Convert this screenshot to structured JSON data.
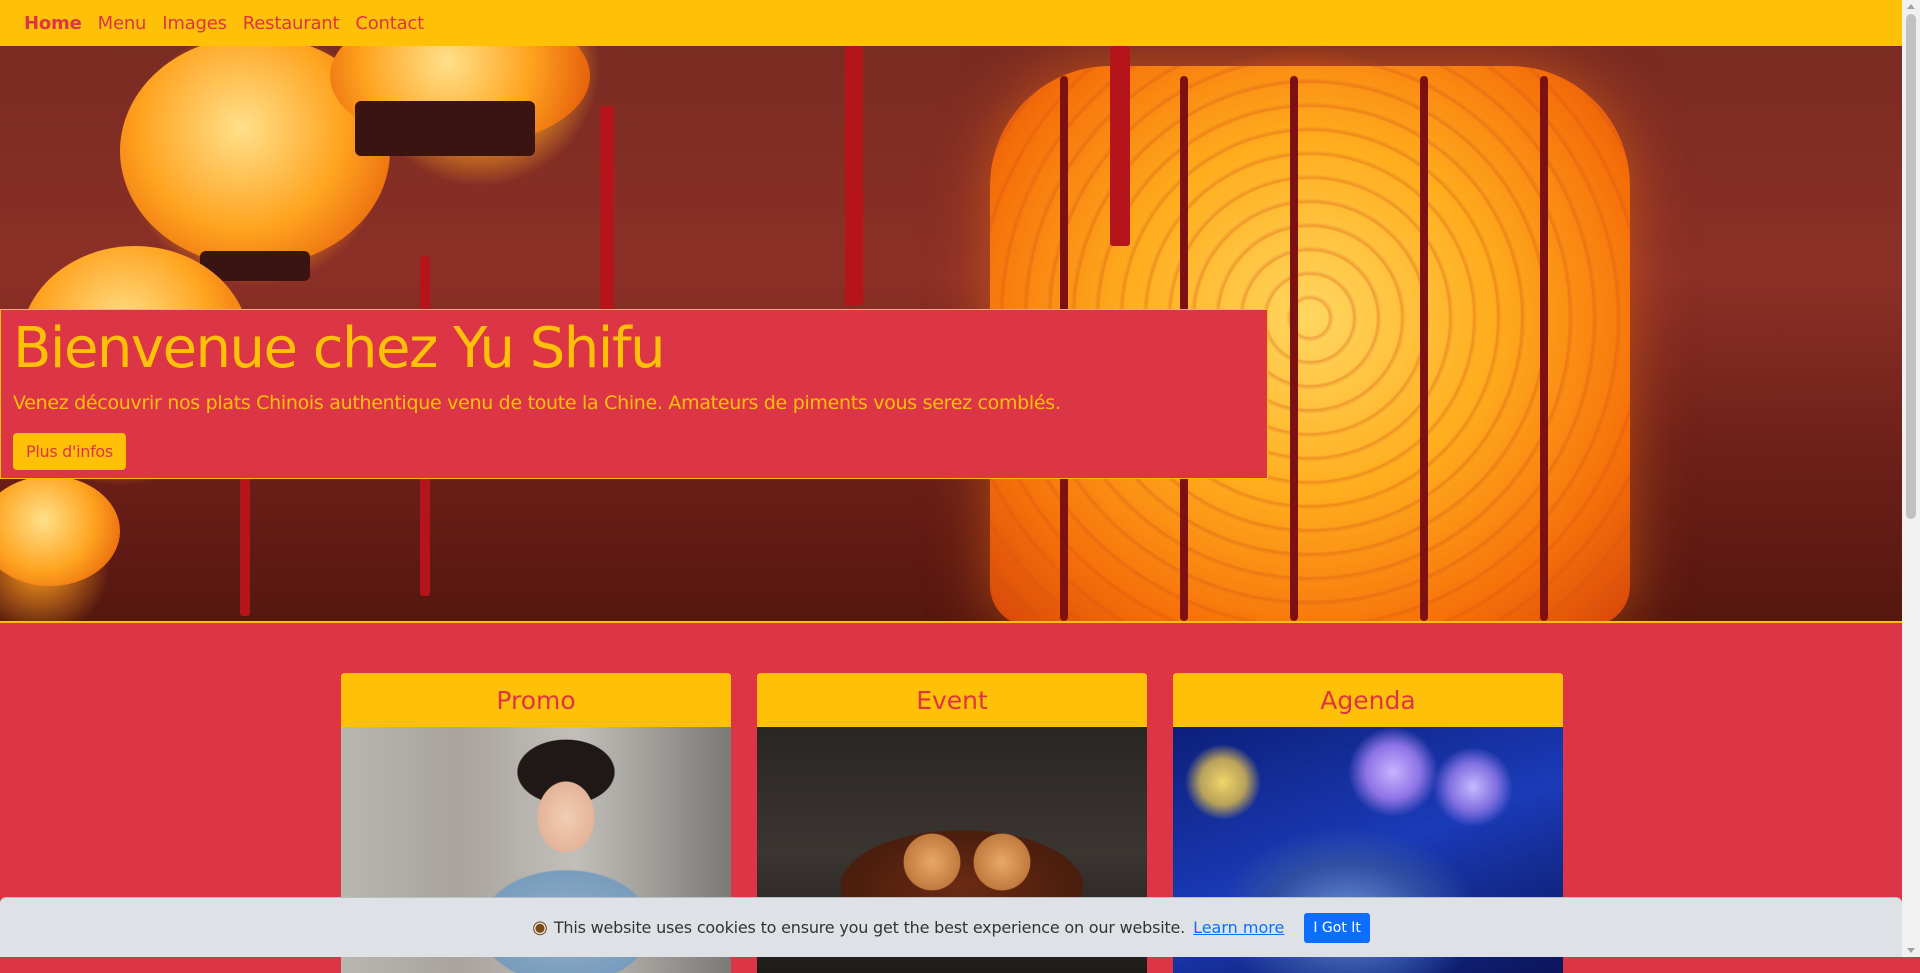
{
  "nav": {
    "items": [
      {
        "label": "Home",
        "active": true
      },
      {
        "label": "Menu"
      },
      {
        "label": "Images"
      },
      {
        "label": "Restaurant"
      },
      {
        "label": "Contact"
      }
    ]
  },
  "hero": {
    "title": "Bienvenue chez Yu Shifu",
    "lead": "Venez découvrir nos plats Chinois authentique venu de toute la Chine. Amateurs de piments vous serez comblés.",
    "button_label": "Plus d'infos"
  },
  "cards": [
    {
      "title": "Promo"
    },
    {
      "title": "Event"
    },
    {
      "title": "Agenda"
    }
  ],
  "cookie": {
    "icon": "cookie-icon",
    "text": "This website uses cookies to ensure you get the best experience on our website.",
    "link_label": "Learn more",
    "button_label": "I Got It"
  },
  "colors": {
    "primary": "#ffc107",
    "danger": "#dc3545",
    "link": "#0d6efd"
  }
}
